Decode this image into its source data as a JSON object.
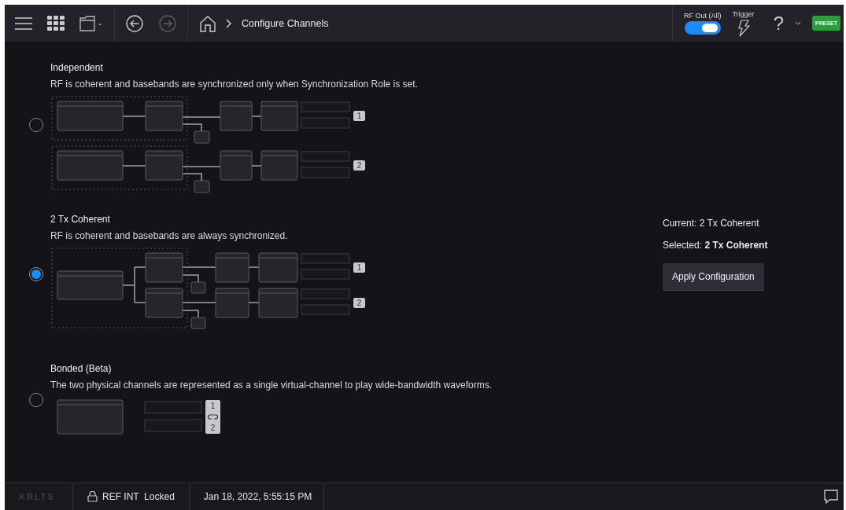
{
  "toolbar": {
    "nav": [
      {
        "kind": "back",
        "disabled": false
      },
      {
        "kind": "forward",
        "disabled": true
      }
    ],
    "breadcrumb": "Configure Channels",
    "rf_out": {
      "label": "RF Out (All)",
      "on": true
    },
    "trigger": {
      "label": "Trigger"
    },
    "help": "?",
    "preset": "PRESET"
  },
  "options": [
    {
      "kind": "independent",
      "title": "Independent",
      "description": "RF is coherent and basebands are synchronized only when Synchronization Role is set.",
      "selected": false,
      "channels": [
        "1",
        "2"
      ]
    },
    {
      "kind": "coherent",
      "title": "2 Tx Coherent",
      "description": "RF is coherent and basebands are always synchronized.",
      "selected": true,
      "channels": [
        "1",
        "2"
      ]
    },
    {
      "kind": "bonded",
      "title": "Bonded (Beta)",
      "description": "The two physical channels are represented as a single virtual-channel to play wide-bandwidth waveforms.",
      "selected": false,
      "channels": [
        "1",
        "2"
      ]
    }
  ],
  "summary": {
    "current": "Current: 2 Tx Coherent",
    "selected": "Selected: **2 Tx Coherent**"
  },
  "apply_button": "Apply Configuration",
  "status_bar": {
    "brand": "KRLTS",
    "reference": "REF INT  Locked",
    "datetime": "Jan 18, 2022, 5:55:15 PM"
  }
}
